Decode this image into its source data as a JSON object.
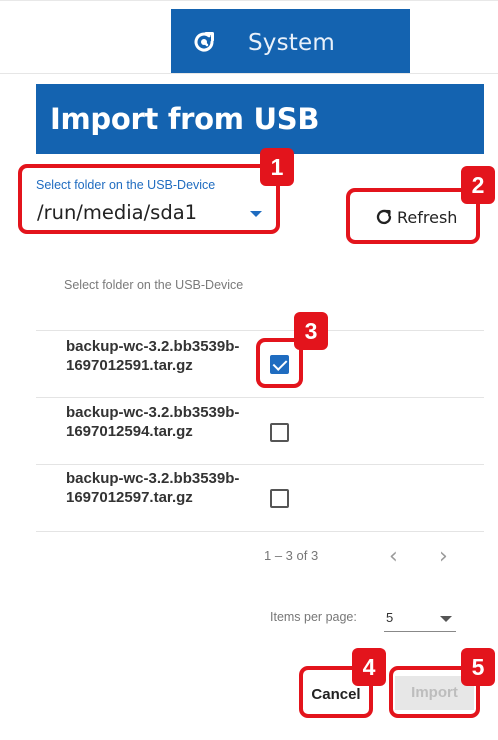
{
  "header": {
    "system_label": "System",
    "icon": "refresh-settings-icon",
    "accent": "#1463b0"
  },
  "dialog": {
    "title": "Import from USB",
    "folder_select": {
      "label": "Select folder on the USB-Device",
      "value": "/run/media/sda1"
    },
    "refresh_label": "Refresh",
    "table": {
      "header": "Select folder on the USB-Device",
      "rows": [
        {
          "name": "backup-wc-3.2.bb3539b-1697012591.tar.gz",
          "checked": true
        },
        {
          "name": "backup-wc-3.2.bb3539b-1697012594.tar.gz",
          "checked": false
        },
        {
          "name": "backup-wc-3.2.bb3539b-1697012597.tar.gz",
          "checked": false
        }
      ]
    },
    "pagination": {
      "range": "1 – 3 of 3",
      "prev": "‹",
      "next": "›",
      "items_per_page_label": "Items per page:",
      "items_per_page_value": "5"
    },
    "actions": {
      "cancel_label": "Cancel",
      "import_label": "Import"
    }
  },
  "annotations": {
    "badges": [
      "1",
      "2",
      "3",
      "4",
      "5"
    ],
    "color": "#e3141c"
  }
}
